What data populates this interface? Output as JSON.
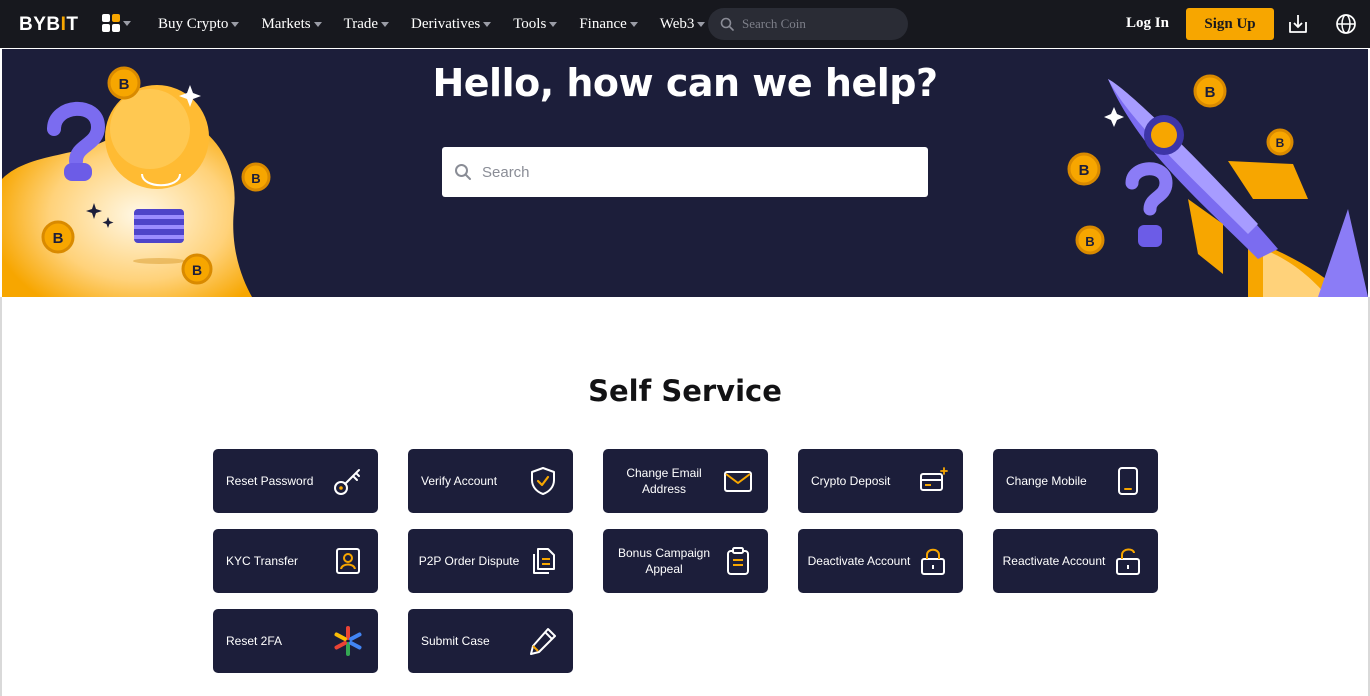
{
  "nav": {
    "logo_text": "BYBIT",
    "menu": [
      {
        "label": "Buy Crypto"
      },
      {
        "label": "Markets"
      },
      {
        "label": "Trade"
      },
      {
        "label": "Derivatives"
      },
      {
        "label": "Tools"
      },
      {
        "label": "Finance"
      },
      {
        "label": "Web3"
      }
    ],
    "search_placeholder": "Search Coin",
    "login_label": "Log In",
    "signup_label": "Sign Up",
    "icons": [
      "apps-grid-icon",
      "download-icon",
      "globe-icon",
      "search-icon"
    ]
  },
  "hero": {
    "title": "Hello, how can we help?",
    "search_placeholder": "Search"
  },
  "self_service": {
    "title": "Self Service",
    "cards": [
      {
        "label": "Reset Password",
        "icon": "key-icon"
      },
      {
        "label": "Verify Account",
        "icon": "shield-check-icon"
      },
      {
        "label": "Change Email Address",
        "icon": "envelope-icon"
      },
      {
        "label": "Crypto Deposit",
        "icon": "card-deposit-icon"
      },
      {
        "label": "Change Mobile",
        "icon": "mobile-phone-icon"
      },
      {
        "label": "KYC Transfer",
        "icon": "id-portrait-icon"
      },
      {
        "label": "P2P Order Dispute",
        "icon": "documents-icon"
      },
      {
        "label": "Bonus Campaign Appeal",
        "icon": "clipboard-icon"
      },
      {
        "label": "Deactivate Account",
        "icon": "lock-closed-icon"
      },
      {
        "label": "Reactivate Account",
        "icon": "lock-open-icon"
      },
      {
        "label": "Reset 2FA",
        "icon": "google-authenticator-icon"
      },
      {
        "label": "Submit Case",
        "icon": "pencil-icon"
      }
    ]
  },
  "colors": {
    "accent": "#f7a600",
    "nav_bg": "#17181e",
    "hero_bg": "#1c1e3a",
    "card_bg": "#1c1e3a"
  }
}
